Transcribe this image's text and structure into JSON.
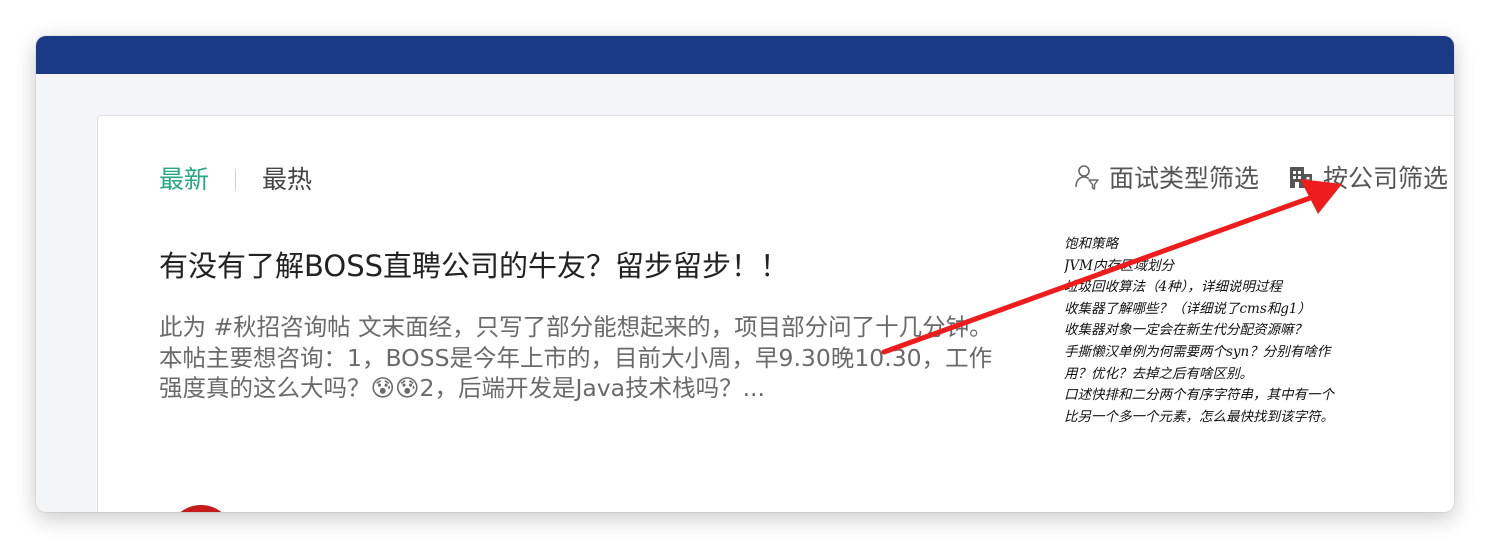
{
  "tabs": [
    {
      "label": "最新",
      "active": true
    },
    {
      "label": "最热",
      "active": false
    }
  ],
  "filters": {
    "interview_type": {
      "label": "面试类型筛选",
      "icon": "person-filter-icon"
    },
    "company": {
      "label": "按公司筛选",
      "icon": "building-icon"
    }
  },
  "post": {
    "title": "有没有了解BOSS直聘公司的牛友？留步留步！！",
    "excerpt": "此为  #秋招咨询帖   文末面经，只写了部分能想起来的，项目部分问了十几分钟。本帖主要想咨询：1，BOSS是今年上市的，目前大小周，早9.30晚10.30，工作强度真的这么大吗？😰😰2，后端开发是Java技术栈吗？...",
    "thumbnail_lines": [
      "饱和策略",
      "JVM内存区域划分",
      "垃圾回收算法（4种），详细说明过程",
      "收集器了解哪些？（详细说了cms和g1）",
      "收集器对象一定会在新生代分配资源嘛？",
      "手撕懒汉单例为何需要两个syn？分别有啥作",
      "用？优化？去掉之后有啥区别。",
      "口述快排和二分两个有序字符串，其中有一个",
      "比另一个多一个元素，怎么最快找到该字符。"
    ]
  },
  "colors": {
    "topbar": "#1a3a85",
    "accent": "#27a882",
    "arrow": "#ee1c1c",
    "avatar": "#c41c1c"
  },
  "annotation": {
    "type": "red-arrow",
    "points_to": "按公司筛选"
  }
}
